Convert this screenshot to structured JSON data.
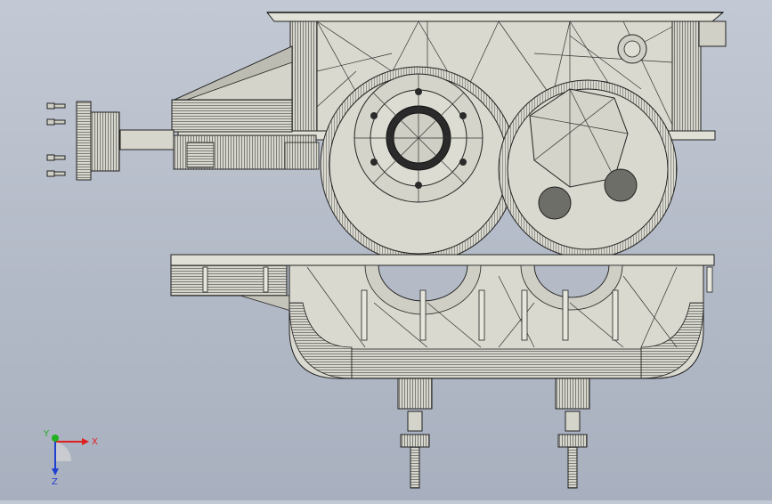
{
  "triad": {
    "x_label": "X",
    "y_label": "Y",
    "z_label": "Z",
    "x_color": "#e02020",
    "y_color": "#20b020",
    "z_color": "#2040d0"
  },
  "colors": {
    "background": "#b8bfcb",
    "part_fill": "#d9d9cf",
    "edge": "#2a2a2a",
    "shadow_fill": "#9a9a92"
  },
  "icons": {
    "triad": "coordinate-triad-icon"
  }
}
